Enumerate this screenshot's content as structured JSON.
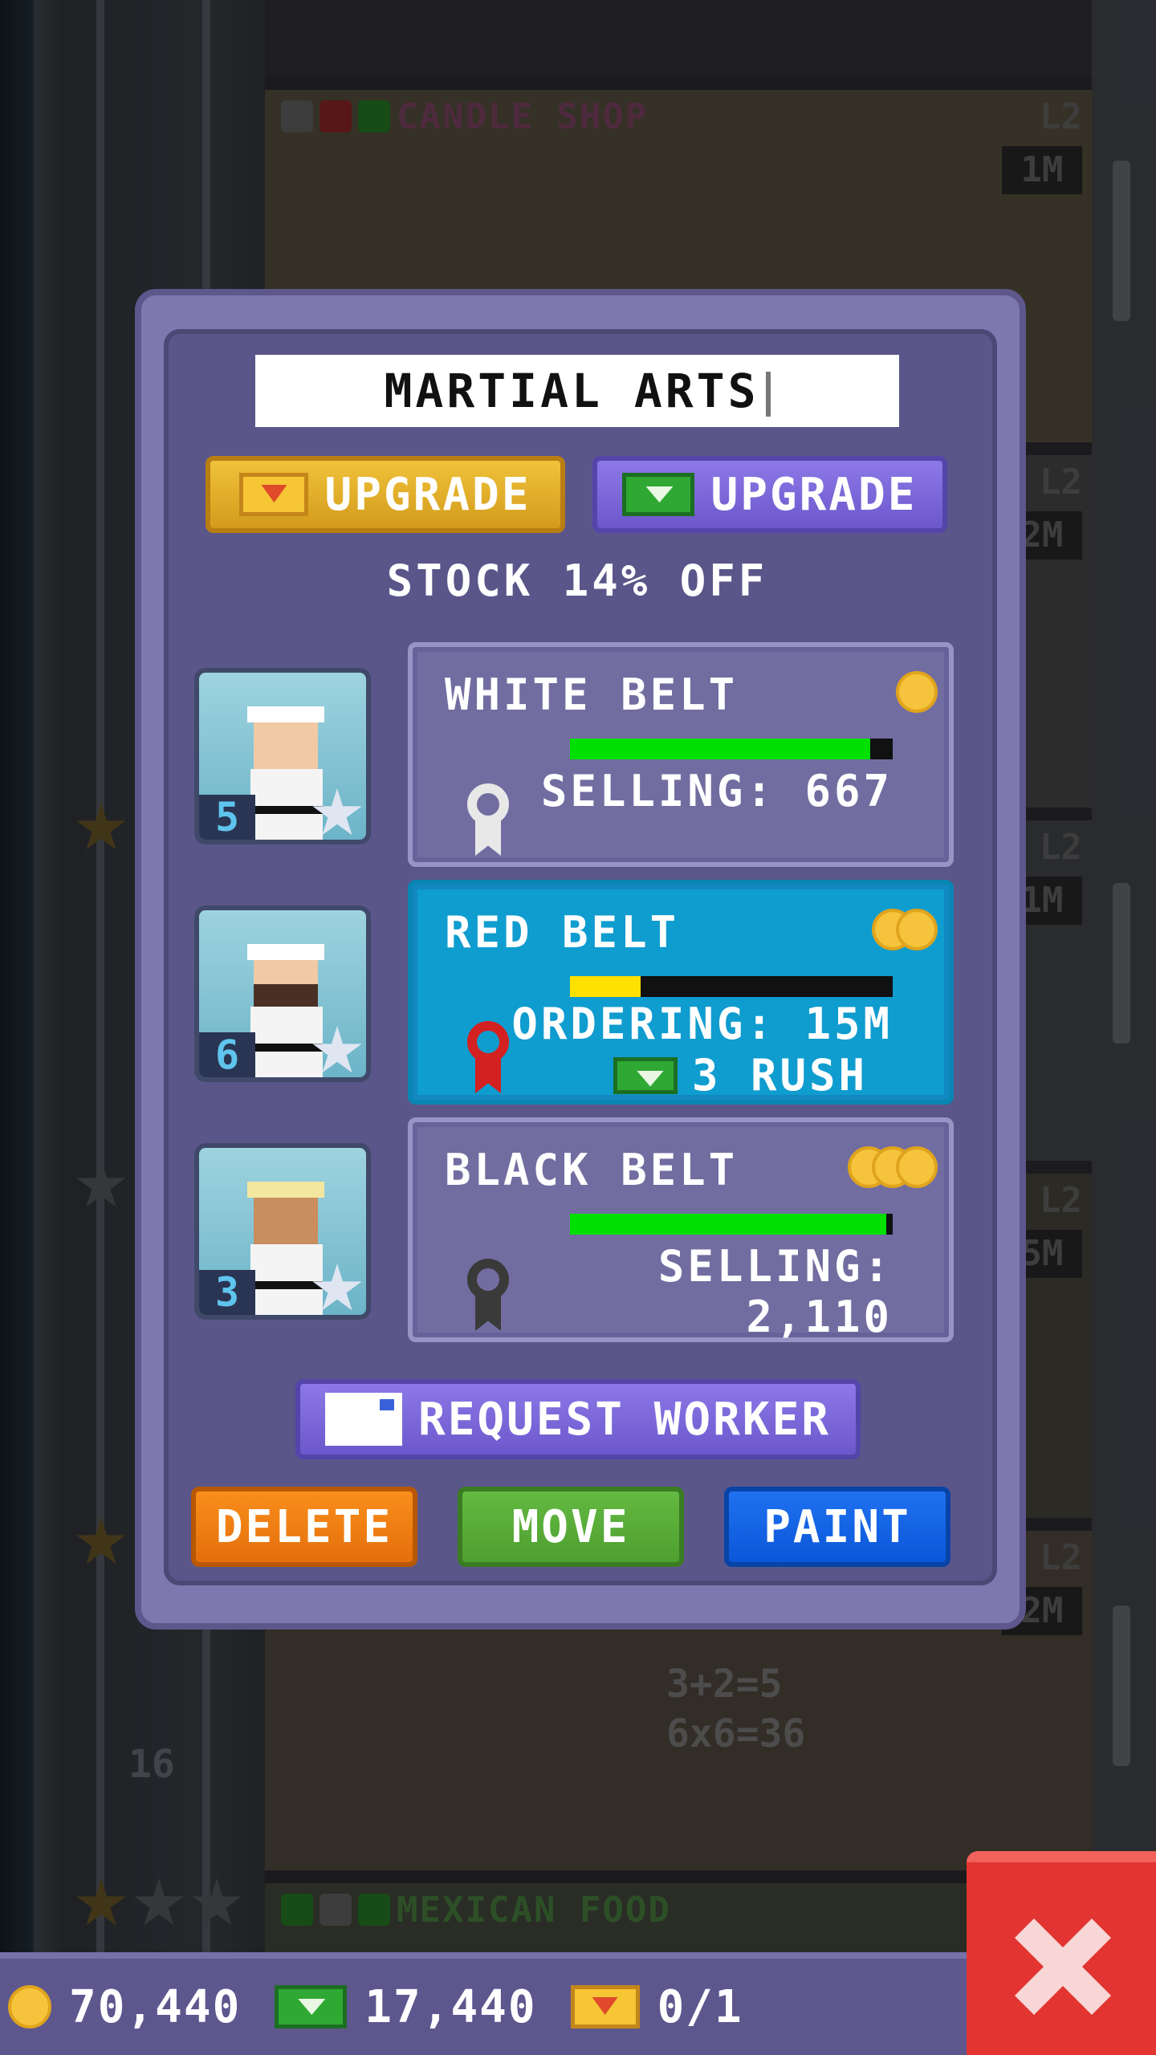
{
  "background": {
    "floors": [
      {
        "name": "CANDLE SHOP",
        "level": "L2",
        "cost": "1M"
      },
      {
        "name": "MEXICAN FOOD",
        "level": "",
        "cost": ""
      }
    ],
    "side_levels": [
      "L2",
      "L2",
      "L2",
      "L2",
      "L2"
    ],
    "side_costs": [
      "2M",
      "1M",
      "5M",
      "2M"
    ],
    "floor_number": "16",
    "chalkboard": [
      "3+2=5",
      "6x6=36"
    ]
  },
  "dialog": {
    "title": "MARTIAL ARTS",
    "upgrade_bux_label": "UPGRADE",
    "upgrade_cash_label": "UPGRADE",
    "promo": "STOCK 14% OFF",
    "workers": [
      {
        "level": "5",
        "icon": "worker-headband-icon"
      },
      {
        "level": "6",
        "icon": "worker-bearded-icon"
      },
      {
        "level": "3",
        "icon": "worker-dark-icon"
      }
    ],
    "stock": [
      {
        "name": "WHITE BELT",
        "status": "SELLING: 667",
        "tier": 1,
        "progress": 0.93,
        "bar_color": "#00e000",
        "medal_color": "#e8e8e8",
        "active": false
      },
      {
        "name": "RED BELT",
        "status": "ORDERING: 15M",
        "tier": 2,
        "progress": 0.22,
        "bar_color": "#ffe000",
        "medal_color": "#d32020",
        "active": true,
        "rush": "3 RUSH"
      },
      {
        "name": "BLACK BELT",
        "status": "SELLING: 2,110",
        "tier": 3,
        "progress": 0.98,
        "bar_color": "#00e000",
        "medal_color": "#3a3a3a",
        "active": false
      }
    ],
    "request_worker_label": "REQUEST WORKER",
    "delete_label": "DELETE",
    "move_label": "MOVE",
    "paint_label": "PAINT"
  },
  "bottom_bar": {
    "coins": "70,440",
    "bux": "17,440",
    "tickets": "0/1"
  },
  "colors": {
    "dialog_bg": "#5b5689",
    "active_panel": "#0f9ccf",
    "gold_button": "#f0c23a",
    "close_button": "#e23431"
  }
}
